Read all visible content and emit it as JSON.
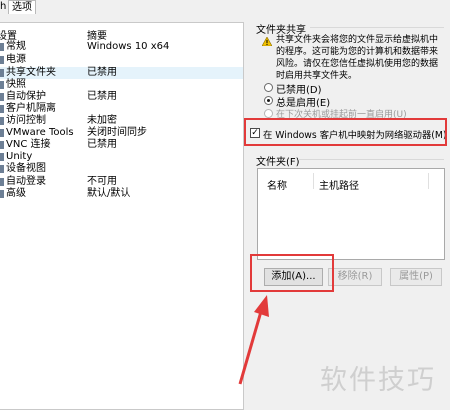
{
  "tabs": {
    "prefix": "h",
    "options": "选项"
  },
  "list": {
    "header_setting": "设置",
    "header_summary": "摘要",
    "rows": [
      {
        "name": "常规",
        "summary": "Windows 10 x64"
      },
      {
        "name": "电源",
        "summary": ""
      },
      {
        "name": "共享文件夹",
        "summary": "已禁用"
      },
      {
        "name": "快照",
        "summary": ""
      },
      {
        "name": "自动保护",
        "summary": "已禁用"
      },
      {
        "name": "客户机隔离",
        "summary": ""
      },
      {
        "name": "访问控制",
        "summary": "未加密"
      },
      {
        "name": "VMware Tools",
        "summary": "关闭时间同步"
      },
      {
        "name": "VNC 连接",
        "summary": "已禁用"
      },
      {
        "name": "Unity",
        "summary": ""
      },
      {
        "name": "设备视图",
        "summary": ""
      },
      {
        "name": "自动登录",
        "summary": "不可用"
      },
      {
        "name": "高级",
        "summary": "默认/默认"
      }
    ]
  },
  "sharing": {
    "group_title": "文件夹共享",
    "warning_line1": "共享文件夹会将您的文件显示给虚拟机中",
    "warning_line2": "的程序。这可能为您的计算机和数据带来",
    "warning_line3": "风险。请仅在您信任虚拟机使用您的数据",
    "warning_line4": "时启用共享文件夹。",
    "option_disabled": "已禁用(D)",
    "option_always": "总是启用(E)",
    "option_until_off": "在下次关机或挂起前一直启用(U)",
    "map_drive_label": "在 Windows 客户机中映射为网络驱动器(M)"
  },
  "folders": {
    "group_title": "文件夹(F)",
    "col_name": "名称",
    "col_host_path": "主机路径",
    "add_button": "添加(A)...",
    "remove_button": "移除(R)",
    "properties_button": "属性(P)"
  },
  "watermark": "软件技巧",
  "colors": {
    "highlight": "#e23a3a",
    "selection": "#e5f3fb"
  }
}
